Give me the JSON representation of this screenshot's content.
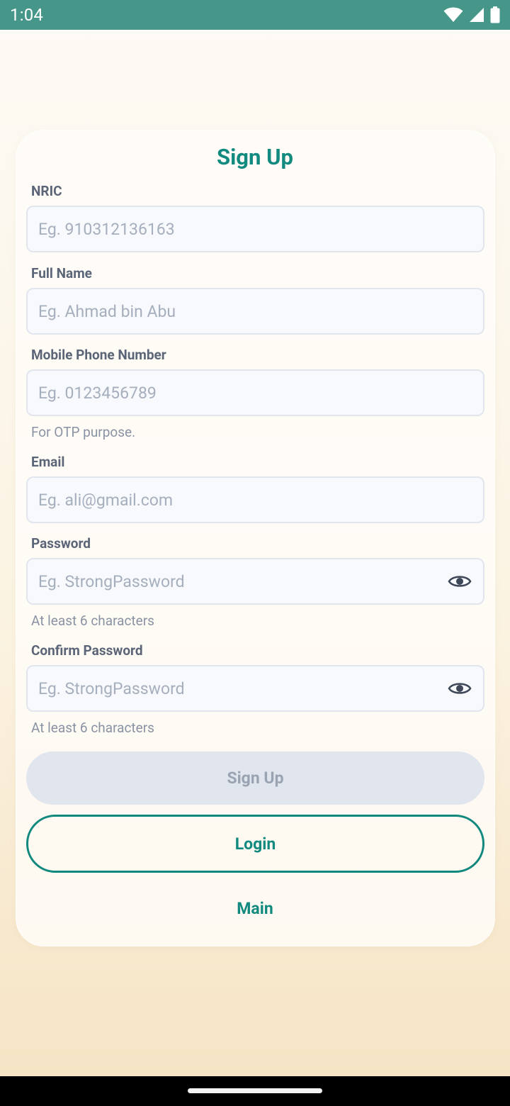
{
  "status_bar": {
    "time": "1:04",
    "icons": [
      "wifi-icon",
      "signal-icon",
      "battery-icon"
    ]
  },
  "form": {
    "title": "Sign Up",
    "fields": [
      {
        "label": "NRIC",
        "placeholder": "Eg. 910312136163",
        "helper": ""
      },
      {
        "label": "Full Name",
        "placeholder": "Eg. Ahmad bin Abu",
        "helper": ""
      },
      {
        "label": "Mobile Phone Number",
        "placeholder": "Eg. 0123456789",
        "helper": "For OTP purpose."
      },
      {
        "label": "Email",
        "placeholder": "Eg. ali@gmail.com",
        "helper": ""
      },
      {
        "label": "Password",
        "placeholder": "Eg. StrongPassword",
        "helper": "At least 6 characters",
        "icon": "eye-icon"
      },
      {
        "label": "Confirm Password",
        "placeholder": "Eg. StrongPassword",
        "helper": "At least 6 characters",
        "icon": "eye-icon"
      }
    ],
    "signup_button": "Sign Up",
    "login_button": "Login",
    "main_link": "Main"
  },
  "colors": {
    "status_bar": "#46968a",
    "accent": "#12897f",
    "disabled_button": "#e1e6ee"
  }
}
